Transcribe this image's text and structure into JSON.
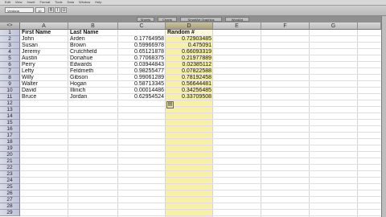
{
  "menubar": {
    "items": [
      "Edit",
      "View",
      "Insert",
      "Format",
      "Tools",
      "Data",
      "Window",
      "Help"
    ]
  },
  "toolbar": {
    "font_name": "Verdana",
    "font_size": "10"
  },
  "ribbon": {
    "tabs": [
      "Sheets",
      "Charts",
      "SmartArt Graphics",
      "WordArt"
    ]
  },
  "grid": {
    "corner": "<>",
    "columns": [
      "A",
      "B",
      "C",
      "D",
      "E",
      "F",
      "G"
    ],
    "rows": [
      "1",
      "2",
      "3",
      "4",
      "5",
      "6",
      "7",
      "8",
      "9",
      "10",
      "11",
      "12",
      "13",
      "14",
      "15",
      "16",
      "17",
      "18",
      "19",
      "20",
      "21",
      "22",
      "23",
      "24",
      "25",
      "26",
      "27",
      "28",
      "29"
    ],
    "selected_column": "D",
    "headers": {
      "first_name": "First Name",
      "last_name": "Last Name",
      "random": "Random #"
    },
    "data": [
      {
        "first": "John",
        "last": "Arden",
        "c": "0.17764958",
        "d": "0.72903485"
      },
      {
        "first": "Susan",
        "last": "Brown",
        "c": "0.59966978",
        "d": "0.475091"
      },
      {
        "first": "Jeremy",
        "last": "Crutchfield",
        "c": "0.65121878",
        "d": "0.66093319"
      },
      {
        "first": "Austin",
        "last": "Donahue",
        "c": "0.77068375",
        "d": "0.21977889"
      },
      {
        "first": "Perry",
        "last": "Edwards",
        "c": "0.03944843",
        "d": "0.02385112"
      },
      {
        "first": "Lefty",
        "last": "Feldmeth",
        "c": "0.98255477",
        "d": "0.07822588"
      },
      {
        "first": "Willy",
        "last": "Gibson",
        "c": "0.99061289",
        "d": "0.78192458"
      },
      {
        "first": "Walter",
        "last": "Hogan",
        "c": "0.58713345",
        "d": "0.56644481"
      },
      {
        "first": "David",
        "last": "Illinich",
        "c": "0.00014486",
        "d": "0.34256485"
      },
      {
        "first": "Bruce",
        "last": "Jordan",
        "c": "0.62954524",
        "d": "0.33709508"
      }
    ]
  },
  "colors": {
    "selected_column": "#f6f0a8",
    "row_header": "#c9cde0"
  }
}
